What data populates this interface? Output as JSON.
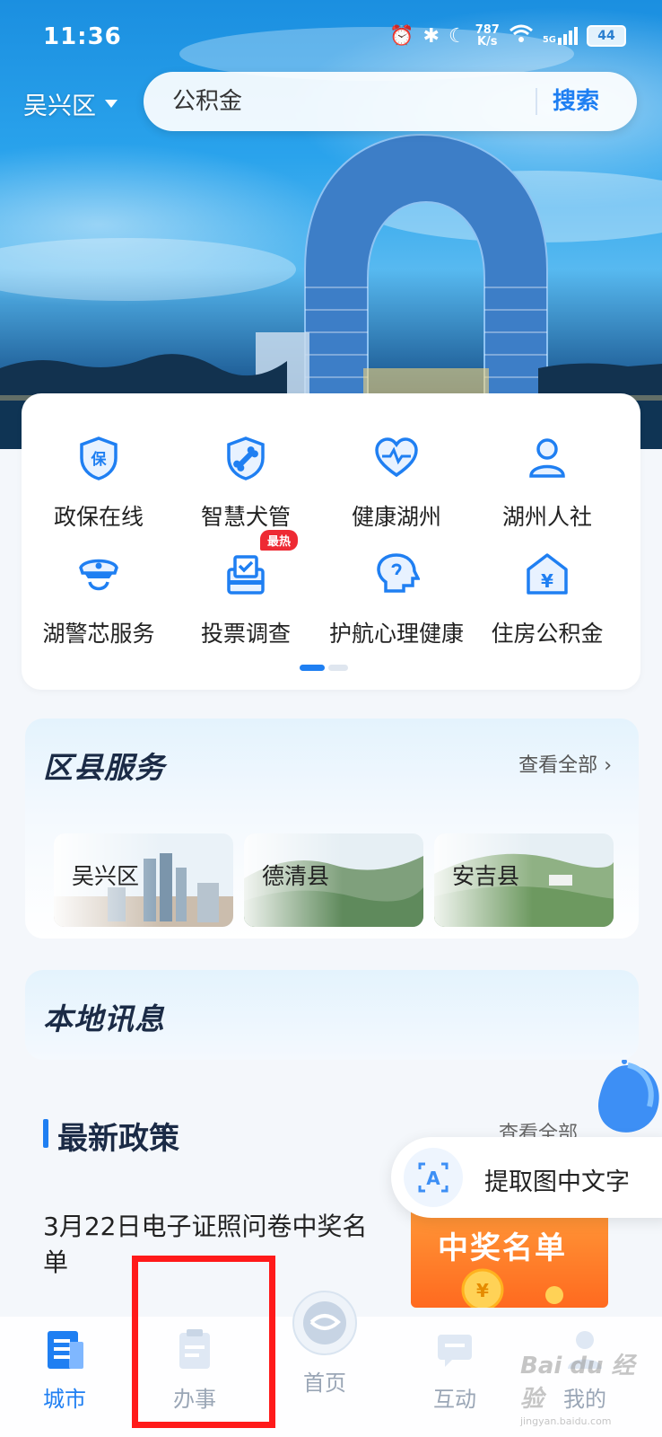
{
  "status_bar": {
    "time": "11:36",
    "net_speed_value": "787",
    "net_speed_unit": "K/s",
    "network": "5G",
    "battery": "44"
  },
  "header": {
    "location": "吴兴区",
    "search_placeholder": "公积金",
    "search_button": "搜索"
  },
  "services": {
    "items": [
      {
        "label": "政保在线",
        "icon": "shield-bao-icon"
      },
      {
        "label": "智慧犬管",
        "icon": "bone-icon"
      },
      {
        "label": "健康湖州",
        "icon": "heart-pulse-icon"
      },
      {
        "label": "湖州人社",
        "icon": "person-service-icon"
      },
      {
        "label": "湖警芯服务",
        "icon": "police-cap-icon"
      },
      {
        "label": "投票调查",
        "icon": "ballot-box-icon",
        "badge": "最热"
      },
      {
        "label": "护航心理健康",
        "icon": "psychology-icon"
      },
      {
        "label": "住房公积金",
        "icon": "house-yuan-icon"
      }
    ],
    "page_count": 2,
    "current_page": 1
  },
  "district": {
    "title": "区县服务",
    "view_all": "查看全部",
    "counties": [
      {
        "name": "吴兴区"
      },
      {
        "name": "德清县"
      },
      {
        "name": "安吉县"
      }
    ]
  },
  "local_news": {
    "title": "本地讯息"
  },
  "policy": {
    "title": "最新政策",
    "view_all": "查看全部",
    "article": {
      "title": "3月22日电子证照问卷中奖名单",
      "thumb_text": "中奖名单"
    }
  },
  "ocr": {
    "label": "提取图中文字"
  },
  "bottom_nav": {
    "items": [
      {
        "label": "城市",
        "active": true
      },
      {
        "label": "办事",
        "active": false
      },
      {
        "label": "首页",
        "active": false
      },
      {
        "label": "互动",
        "active": false
      },
      {
        "label": "我的",
        "active": false
      }
    ]
  },
  "watermark": {
    "brand": "Bai du 经验",
    "domain": "jingyan.baidu.com"
  },
  "colors": {
    "accent": "#1f7ff2",
    "highlight": "#ff1a1a",
    "hot_badge": "#ee2a33"
  }
}
